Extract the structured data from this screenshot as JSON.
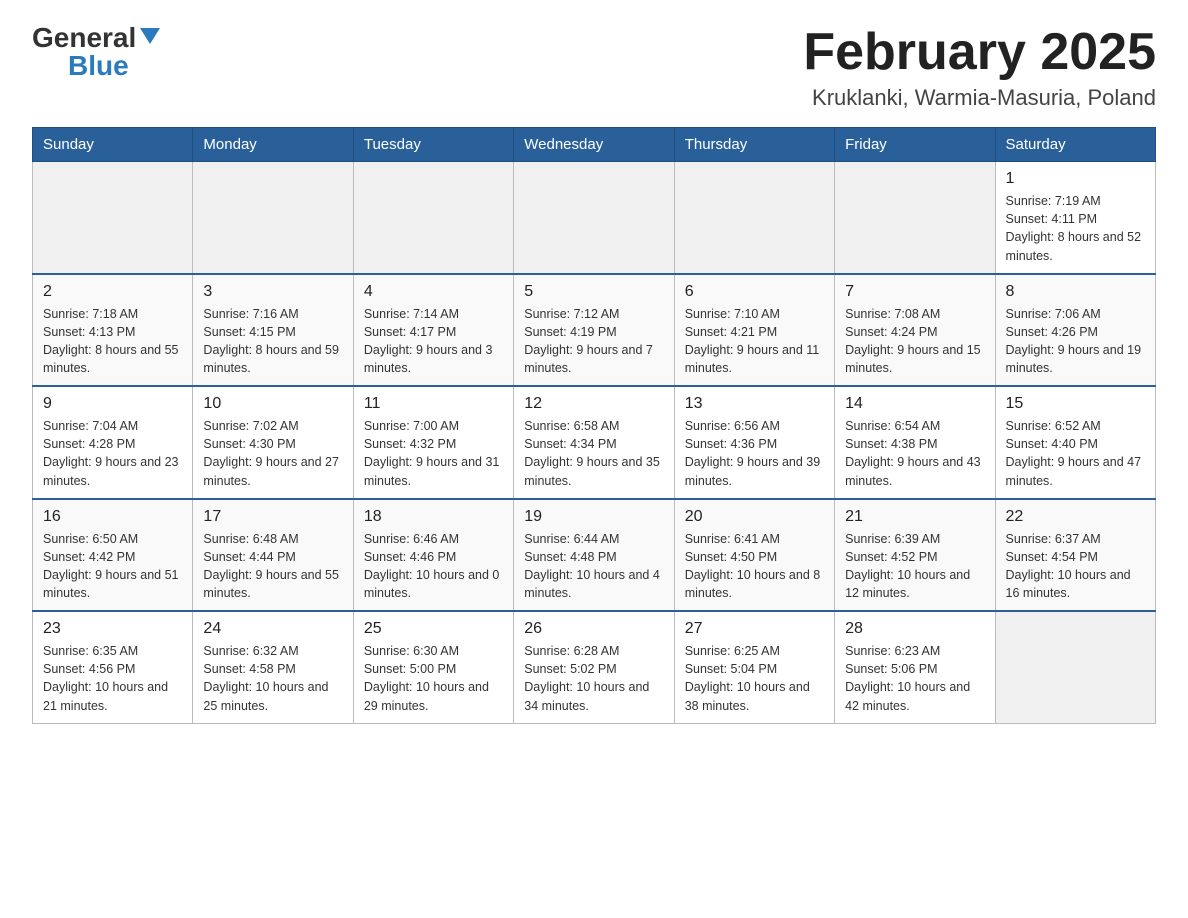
{
  "header": {
    "logo_general": "General",
    "logo_blue": "Blue",
    "month_title": "February 2025",
    "location": "Kruklanki, Warmia-Masuria, Poland"
  },
  "days_of_week": [
    "Sunday",
    "Monday",
    "Tuesday",
    "Wednesday",
    "Thursday",
    "Friday",
    "Saturday"
  ],
  "weeks": [
    {
      "days": [
        {
          "number": "",
          "info": ""
        },
        {
          "number": "",
          "info": ""
        },
        {
          "number": "",
          "info": ""
        },
        {
          "number": "",
          "info": ""
        },
        {
          "number": "",
          "info": ""
        },
        {
          "number": "",
          "info": ""
        },
        {
          "number": "1",
          "info": "Sunrise: 7:19 AM\nSunset: 4:11 PM\nDaylight: 8 hours and 52 minutes."
        }
      ]
    },
    {
      "days": [
        {
          "number": "2",
          "info": "Sunrise: 7:18 AM\nSunset: 4:13 PM\nDaylight: 8 hours and 55 minutes."
        },
        {
          "number": "3",
          "info": "Sunrise: 7:16 AM\nSunset: 4:15 PM\nDaylight: 8 hours and 59 minutes."
        },
        {
          "number": "4",
          "info": "Sunrise: 7:14 AM\nSunset: 4:17 PM\nDaylight: 9 hours and 3 minutes."
        },
        {
          "number": "5",
          "info": "Sunrise: 7:12 AM\nSunset: 4:19 PM\nDaylight: 9 hours and 7 minutes."
        },
        {
          "number": "6",
          "info": "Sunrise: 7:10 AM\nSunset: 4:21 PM\nDaylight: 9 hours and 11 minutes."
        },
        {
          "number": "7",
          "info": "Sunrise: 7:08 AM\nSunset: 4:24 PM\nDaylight: 9 hours and 15 minutes."
        },
        {
          "number": "8",
          "info": "Sunrise: 7:06 AM\nSunset: 4:26 PM\nDaylight: 9 hours and 19 minutes."
        }
      ]
    },
    {
      "days": [
        {
          "number": "9",
          "info": "Sunrise: 7:04 AM\nSunset: 4:28 PM\nDaylight: 9 hours and 23 minutes."
        },
        {
          "number": "10",
          "info": "Sunrise: 7:02 AM\nSunset: 4:30 PM\nDaylight: 9 hours and 27 minutes."
        },
        {
          "number": "11",
          "info": "Sunrise: 7:00 AM\nSunset: 4:32 PM\nDaylight: 9 hours and 31 minutes."
        },
        {
          "number": "12",
          "info": "Sunrise: 6:58 AM\nSunset: 4:34 PM\nDaylight: 9 hours and 35 minutes."
        },
        {
          "number": "13",
          "info": "Sunrise: 6:56 AM\nSunset: 4:36 PM\nDaylight: 9 hours and 39 minutes."
        },
        {
          "number": "14",
          "info": "Sunrise: 6:54 AM\nSunset: 4:38 PM\nDaylight: 9 hours and 43 minutes."
        },
        {
          "number": "15",
          "info": "Sunrise: 6:52 AM\nSunset: 4:40 PM\nDaylight: 9 hours and 47 minutes."
        }
      ]
    },
    {
      "days": [
        {
          "number": "16",
          "info": "Sunrise: 6:50 AM\nSunset: 4:42 PM\nDaylight: 9 hours and 51 minutes."
        },
        {
          "number": "17",
          "info": "Sunrise: 6:48 AM\nSunset: 4:44 PM\nDaylight: 9 hours and 55 minutes."
        },
        {
          "number": "18",
          "info": "Sunrise: 6:46 AM\nSunset: 4:46 PM\nDaylight: 10 hours and 0 minutes."
        },
        {
          "number": "19",
          "info": "Sunrise: 6:44 AM\nSunset: 4:48 PM\nDaylight: 10 hours and 4 minutes."
        },
        {
          "number": "20",
          "info": "Sunrise: 6:41 AM\nSunset: 4:50 PM\nDaylight: 10 hours and 8 minutes."
        },
        {
          "number": "21",
          "info": "Sunrise: 6:39 AM\nSunset: 4:52 PM\nDaylight: 10 hours and 12 minutes."
        },
        {
          "number": "22",
          "info": "Sunrise: 6:37 AM\nSunset: 4:54 PM\nDaylight: 10 hours and 16 minutes."
        }
      ]
    },
    {
      "days": [
        {
          "number": "23",
          "info": "Sunrise: 6:35 AM\nSunset: 4:56 PM\nDaylight: 10 hours and 21 minutes."
        },
        {
          "number": "24",
          "info": "Sunrise: 6:32 AM\nSunset: 4:58 PM\nDaylight: 10 hours and 25 minutes."
        },
        {
          "number": "25",
          "info": "Sunrise: 6:30 AM\nSunset: 5:00 PM\nDaylight: 10 hours and 29 minutes."
        },
        {
          "number": "26",
          "info": "Sunrise: 6:28 AM\nSunset: 5:02 PM\nDaylight: 10 hours and 34 minutes."
        },
        {
          "number": "27",
          "info": "Sunrise: 6:25 AM\nSunset: 5:04 PM\nDaylight: 10 hours and 38 minutes."
        },
        {
          "number": "28",
          "info": "Sunrise: 6:23 AM\nSunset: 5:06 PM\nDaylight: 10 hours and 42 minutes."
        },
        {
          "number": "",
          "info": ""
        }
      ]
    }
  ]
}
